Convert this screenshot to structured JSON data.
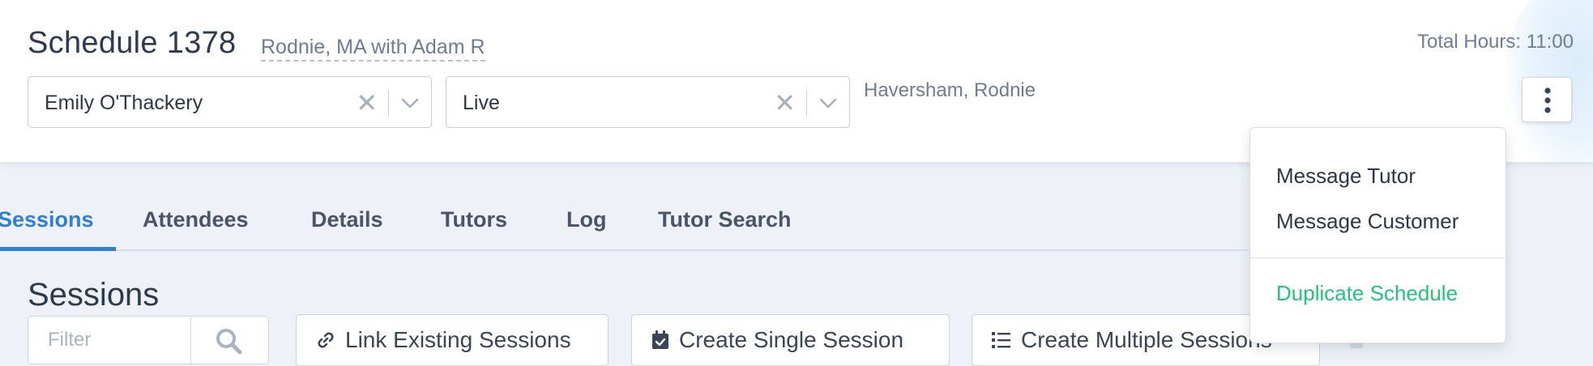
{
  "header": {
    "title": "Schedule 1378",
    "subtitle": "Rodnie, MA with Adam R",
    "total_hours": "Total Hours: 11:00",
    "tutor_select": {
      "value": "Emily O'Thackery"
    },
    "status_select": {
      "value": "Live"
    },
    "location": "Haversham, Rodnie"
  },
  "menu": {
    "items": [
      "Message Tutor",
      "Message Customer",
      "Duplicate Schedule"
    ]
  },
  "tabs": [
    {
      "label": "Sessions",
      "active": true
    },
    {
      "label": "Attendees"
    },
    {
      "label": "Details"
    },
    {
      "label": "Tutors"
    },
    {
      "label": "Log"
    },
    {
      "label": "Tutor Search"
    }
  ],
  "sessions": {
    "title": "Sessions",
    "filter_placeholder": "Filter",
    "buttons": {
      "link": "Link Existing Sessions",
      "single": "Create Single Session",
      "multiple": "Create Multiple Sessions"
    }
  },
  "icons": {
    "search": "search-icon",
    "link": "link-icon",
    "calendar": "calendar-check-icon",
    "list": "list-icon",
    "kebab": "vertical-ellipsis-icon",
    "clear": "clear-x-icon",
    "chevron": "chevron-down-icon"
  },
  "colors": {
    "accent": "#2f7fd8",
    "success": "#21c57a",
    "muted_text": "#6e7d92",
    "background": "#eef2f8"
  }
}
